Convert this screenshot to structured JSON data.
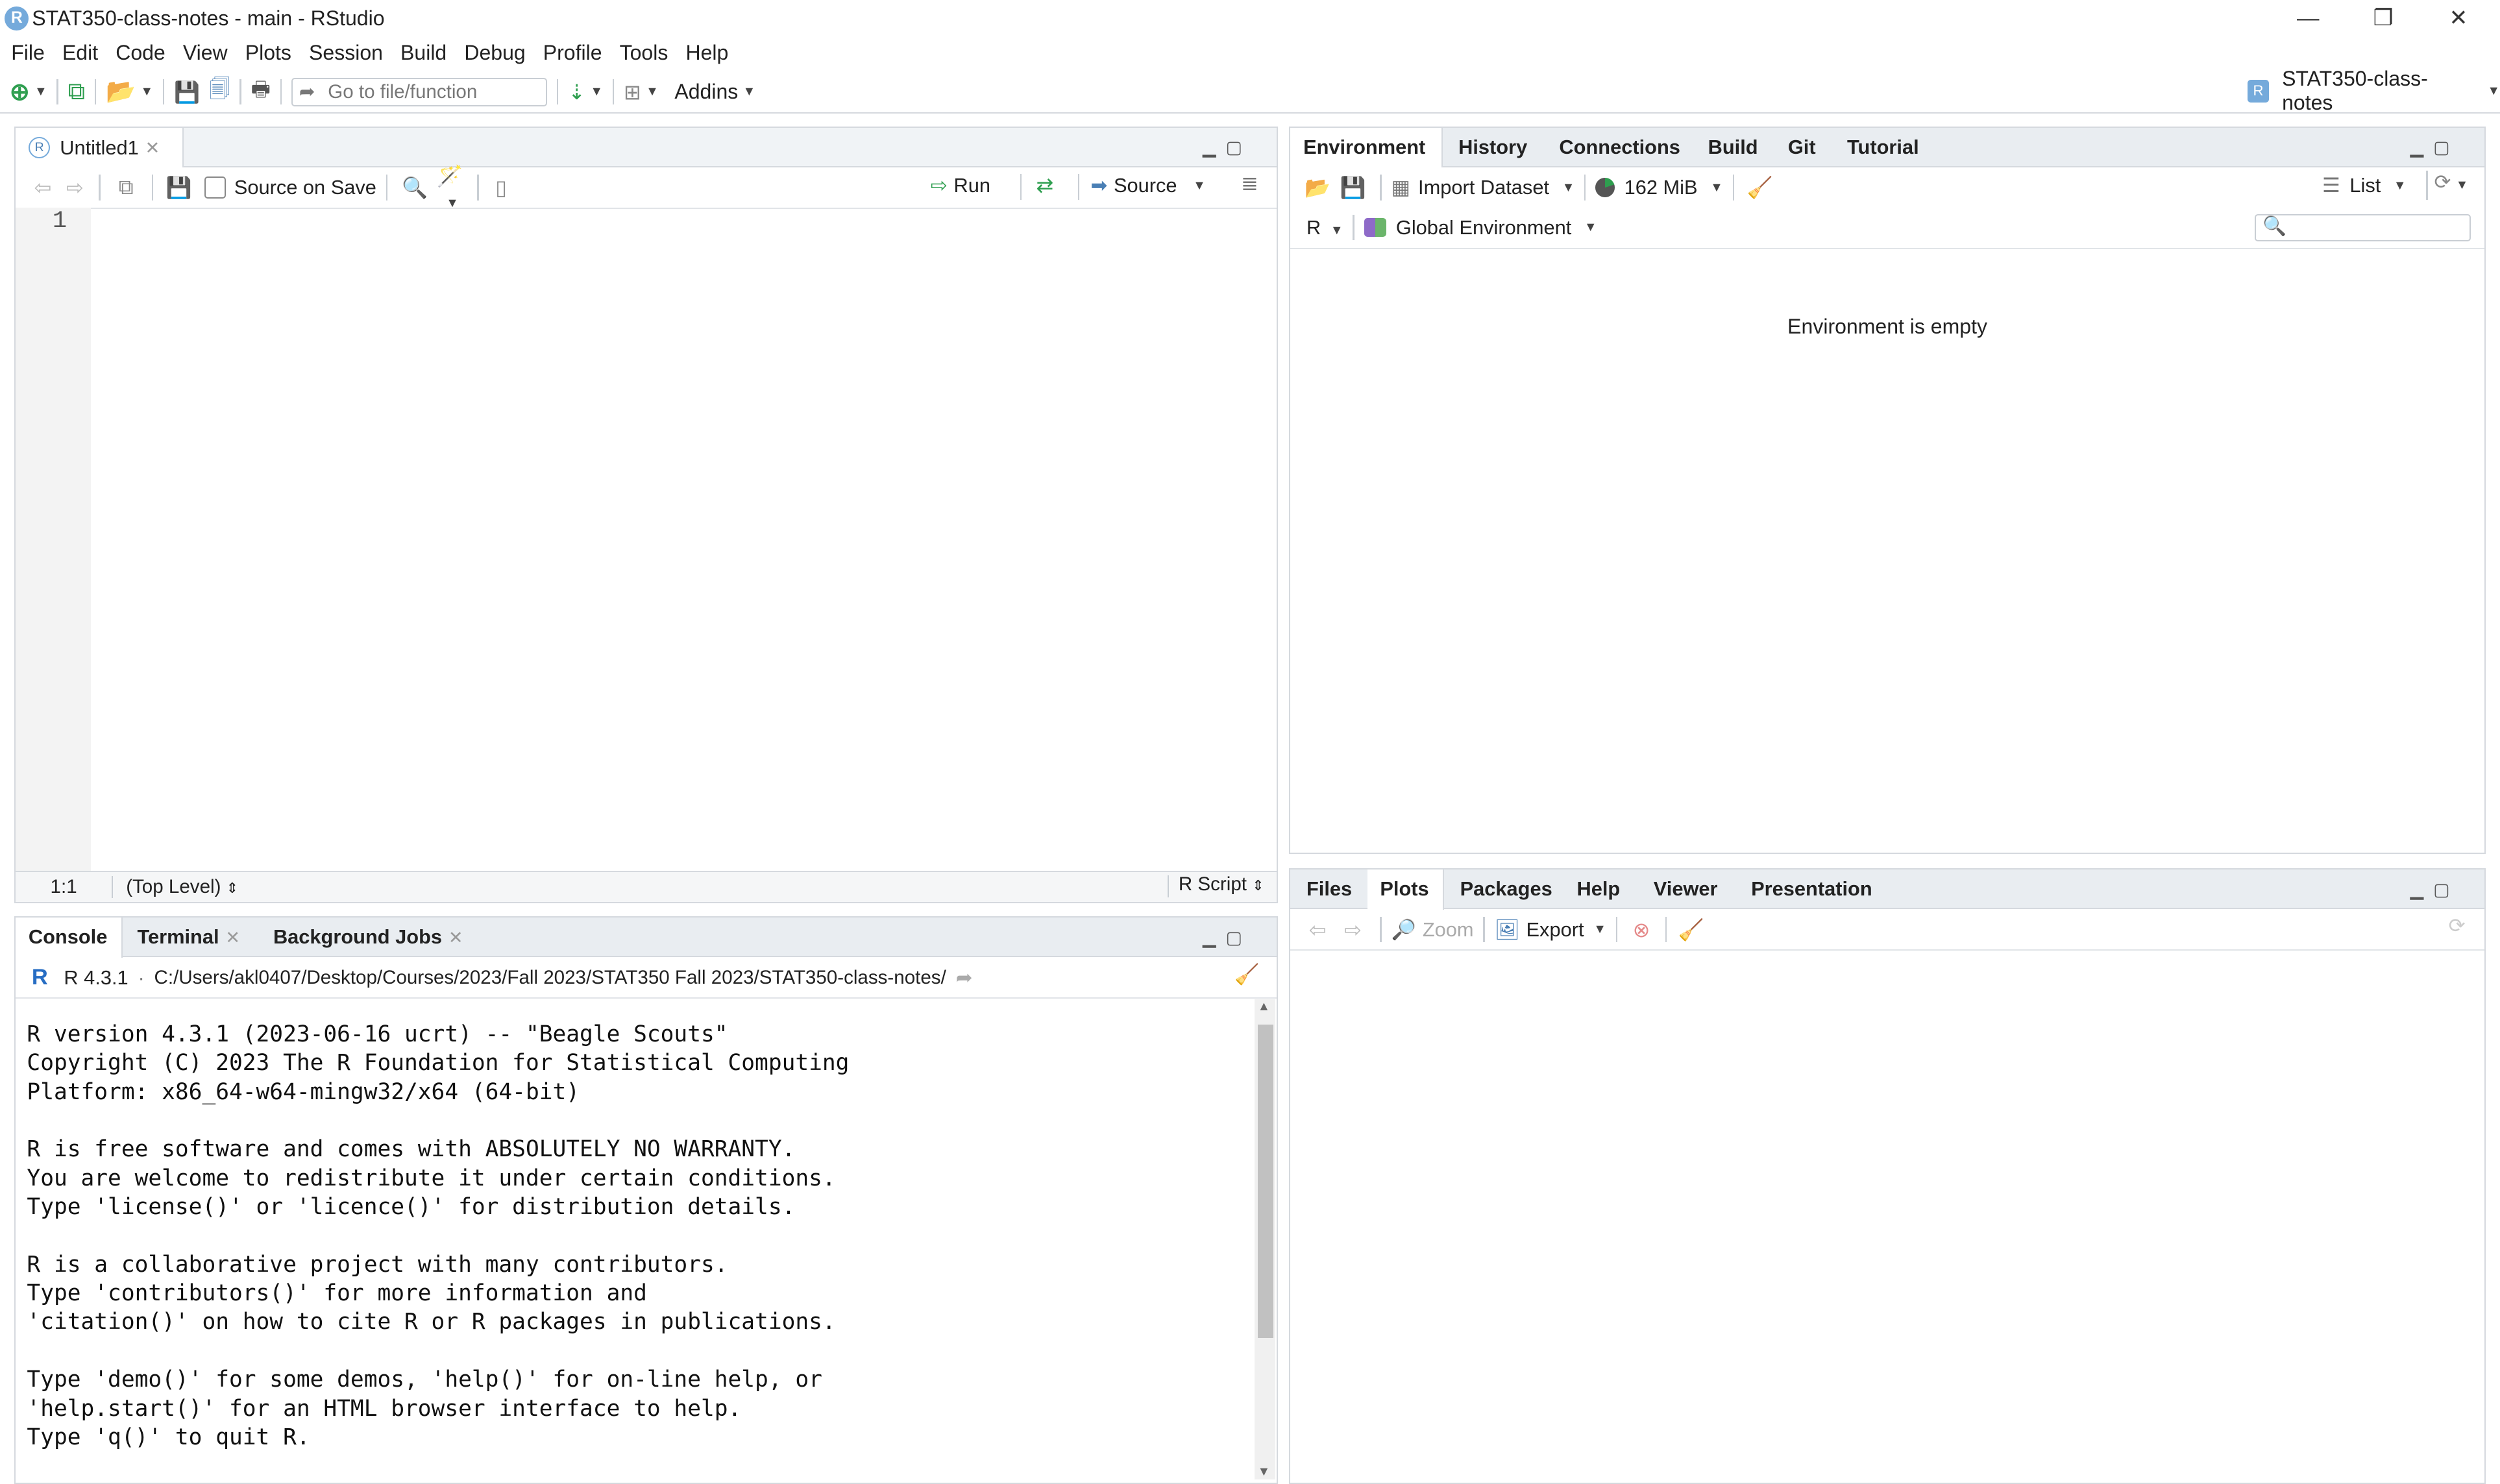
{
  "window": {
    "title": "STAT350-class-notes - main - RStudio",
    "app_icon_letter": "R",
    "minimize": "—",
    "restore": "❐",
    "close": "✕"
  },
  "menu": [
    "File",
    "Edit",
    "Code",
    "View",
    "Plots",
    "Session",
    "Build",
    "Debug",
    "Profile",
    "Tools",
    "Help"
  ],
  "toolbar": {
    "goto_placeholder": "Go to file/function",
    "addins_label": "Addins",
    "project_label": "STAT350-class-notes"
  },
  "source_pane": {
    "tab_label": "Untitled1",
    "source_on_save_label": "Source on Save",
    "run_label": "Run",
    "source_label": "Source",
    "line_number": "1",
    "cursor_position": "1:1",
    "scope": "(Top Level)",
    "file_type": "R Script"
  },
  "console_pane": {
    "tabs": [
      "Console",
      "Terminal",
      "Background Jobs"
    ],
    "r_version": "R 4.3.1",
    "path": "C:/Users/akl0407/Desktop/Courses/2023/Fall 2023/STAT350 Fall 2023/STAT350-class-notes/",
    "output": "R version 4.3.1 (2023-06-16 ucrt) -- \"Beagle Scouts\"\nCopyright (C) 2023 The R Foundation for Statistical Computing\nPlatform: x86_64-w64-mingw32/x64 (64-bit)\n\nR is free software and comes with ABSOLUTELY NO WARRANTY.\nYou are welcome to redistribute it under certain conditions.\nType 'license()' or 'licence()' for distribution details.\n\nR is a collaborative project with many contributors.\nType 'contributors()' for more information and\n'citation()' on how to cite R or R packages in publications.\n\nType 'demo()' for some demos, 'help()' for on-line help, or\n'help.start()' for an HTML browser interface to help.\nType 'q()' to quit R."
  },
  "env_pane": {
    "tabs": [
      "Environment",
      "History",
      "Connections",
      "Build",
      "Git",
      "Tutorial"
    ],
    "import_dataset_label": "Import Dataset",
    "memory_label": "162 MiB",
    "list_label": "List",
    "language_label": "R",
    "environment_label": "Global Environment",
    "empty_message": "Environment is empty"
  },
  "files_pane": {
    "tabs": [
      "Files",
      "Plots",
      "Packages",
      "Help",
      "Viewer",
      "Presentation"
    ],
    "zoom_label": "Zoom",
    "export_label": "Export"
  },
  "colors": {
    "tab_strip": "#e9edf1",
    "border": "#d5d9de",
    "run_arrow": "#2e9e4f",
    "accent_blue": "#75aadb"
  }
}
